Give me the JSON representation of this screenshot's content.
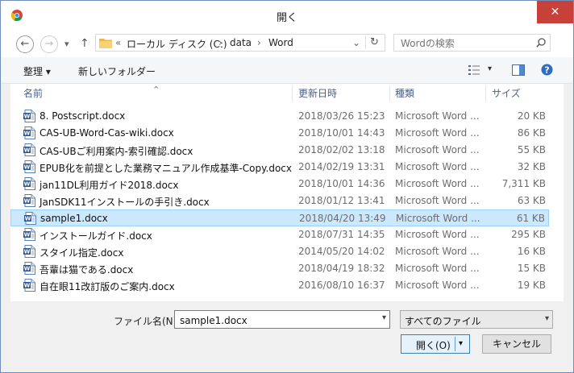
{
  "window": {
    "title": "開く",
    "close_glyph": "✕"
  },
  "nav": {
    "back_glyph": "←",
    "forward_glyph": "→",
    "recent_glyph": "▾",
    "up_glyph": "↑",
    "breadcrumb_prefix": "«",
    "breadcrumb": [
      "ローカル ディスク (C:)",
      "data",
      "Word"
    ],
    "separator": "›",
    "dropdown_glyph": "⌄",
    "refresh_glyph": "↻"
  },
  "search": {
    "placeholder": "Wordの検索"
  },
  "toolbar": {
    "organize_label": "整理 ▾",
    "new_folder_label": "新しいフォルダー",
    "view_menu_glyph": "▾",
    "help_glyph": "?"
  },
  "columns": {
    "name": "名前",
    "modified": "更新日時",
    "type": "種類",
    "size": "サイズ",
    "sort_glyph": "⌃"
  },
  "files": [
    {
      "name": "8. Postscript.docx",
      "modified": "2018/03/26 15:23",
      "type": "Microsoft Word ...",
      "size": "20 KB"
    },
    {
      "name": "CAS-UB-Word-Cas-wiki.docx",
      "modified": "2018/10/01 14:43",
      "type": "Microsoft Word ...",
      "size": "86 KB"
    },
    {
      "name": "CAS-UBご利用案内-索引確認.docx",
      "modified": "2018/02/02 13:18",
      "type": "Microsoft Word ...",
      "size": "55 KB"
    },
    {
      "name": "EPUB化を前提とした業務マニュアル作成基準-Copy.docx",
      "modified": "2014/02/19 13:31",
      "type": "Microsoft Word ...",
      "size": "32 KB"
    },
    {
      "name": "jan11DL利用ガイド2018.docx",
      "modified": "2018/10/01 14:36",
      "type": "Microsoft Word ...",
      "size": "7,311 KB"
    },
    {
      "name": "JanSDK11インストールの手引き.docx",
      "modified": "2018/01/12 13:41",
      "type": "Microsoft Word ...",
      "size": "63 KB"
    },
    {
      "name": "sample1.docx",
      "modified": "2018/04/20 13:49",
      "type": "Microsoft Word ...",
      "size": "61 KB",
      "selected": true
    },
    {
      "name": "インストールガイド.docx",
      "modified": "2018/07/31 14:35",
      "type": "Microsoft Word ...",
      "size": "295 KB"
    },
    {
      "name": "スタイル指定.docx",
      "modified": "2014/05/20 14:02",
      "type": "Microsoft Word ...",
      "size": "16 KB"
    },
    {
      "name": "吾輩は猫である.docx",
      "modified": "2018/04/19 18:32",
      "type": "Microsoft Word ...",
      "size": "15 KB"
    },
    {
      "name": "自在眼11改訂版のご案内.docx",
      "modified": "2016/08/10 16:37",
      "type": "Microsoft Word ...",
      "size": "19 KB"
    }
  ],
  "footer": {
    "filename_label": "ファイル名(N):",
    "filename_value": "sample1.docx",
    "dropdown_glyph": "▾",
    "filter_value": "すべてのファイル",
    "open_label": "開く(O)",
    "open_split_glyph": "▾",
    "cancel_label": "キャンセル"
  },
  "colors": {
    "selection": "#cce8ff",
    "selection_border": "#99d1ff",
    "close_red": "#c7403a",
    "column_header": "#4d6185"
  }
}
